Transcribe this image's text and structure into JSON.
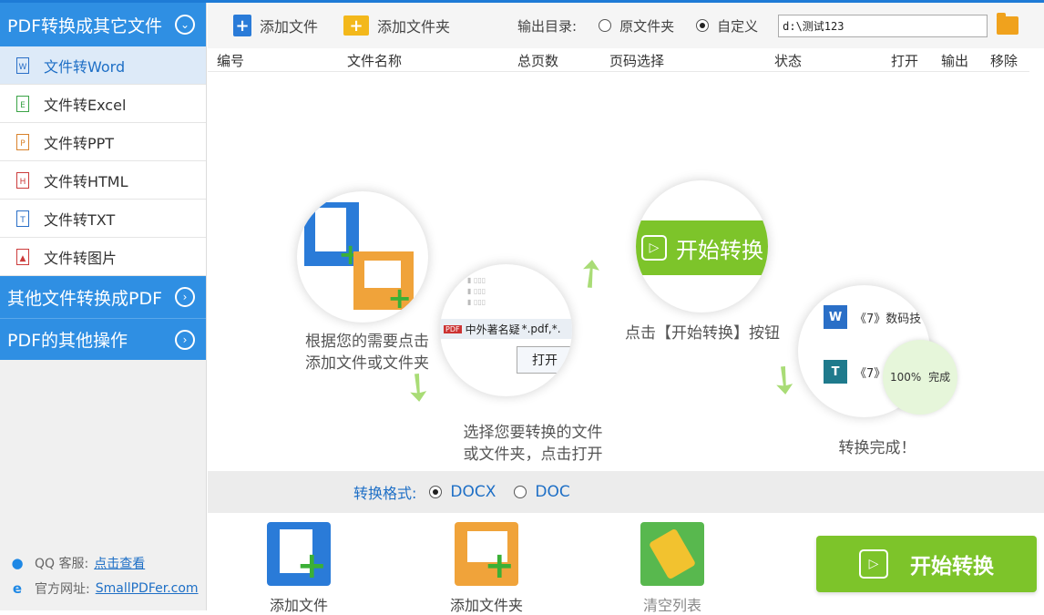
{
  "sidebar": {
    "categories": [
      {
        "label": "PDF转换成其它文件",
        "expanded": true
      },
      {
        "label": "其他文件转换成PDF",
        "expanded": false
      },
      {
        "label": "PDF的其他操作",
        "expanded": false
      }
    ],
    "items": [
      {
        "label": "文件转Word",
        "icon": "word-file-icon",
        "glyph": "W",
        "active": true
      },
      {
        "label": "文件转Excel",
        "icon": "excel-file-icon",
        "glyph": "E",
        "active": false
      },
      {
        "label": "文件转PPT",
        "icon": "ppt-file-icon",
        "glyph": "P",
        "active": false
      },
      {
        "label": "文件转HTML",
        "icon": "html-file-icon",
        "glyph": "H",
        "active": false
      },
      {
        "label": "文件转TXT",
        "icon": "txt-file-icon",
        "glyph": "T",
        "active": false
      },
      {
        "label": "文件转图片",
        "icon": "image-file-icon",
        "glyph": "▲",
        "active": false
      }
    ],
    "footer": {
      "qq_label": "QQ 客服:",
      "qq_link": "点击查看",
      "site_label": "官方网址:",
      "site_link": "SmallPDFer.com"
    }
  },
  "toolbar": {
    "add_file": "添加文件",
    "add_folder": "添加文件夹",
    "output_label": "输出目录:",
    "option_original": "原文件夹",
    "option_custom": "自定义",
    "selected_option": "custom",
    "output_path": "d:\\测试123"
  },
  "table": {
    "headers": [
      "编号",
      "文件名称",
      "总页数",
      "页码选择",
      "状态",
      "打开",
      "输出",
      "移除"
    ]
  },
  "guide": {
    "step1": [
      "根据您的需要点击",
      "添加文件或文件夹"
    ],
    "step2": [
      "选择您要转换的文件",
      "或文件夹，点击打开"
    ],
    "step2_file": "中外著名疑",
    "step2_filter": "*.pdf,*.",
    "step2_open": "打开",
    "step3": "点击【开始转换】按钮",
    "step3_button": "开始转换",
    "step4": "转换完成！",
    "step4_row1": "《7》数码技",
    "step4_row2": "《7》",
    "step4_progress": "100%",
    "step4_done": "完成"
  },
  "format": {
    "label": "转换格式:",
    "options": [
      "DOCX",
      "DOC"
    ],
    "selected": "DOCX"
  },
  "bottom": {
    "add_file": "添加文件",
    "add_folder": "添加文件夹",
    "clear_list": "清空列表",
    "start": "开始转换"
  },
  "colors": {
    "accent_blue": "#2f8fe3",
    "green": "#7dc42a"
  }
}
